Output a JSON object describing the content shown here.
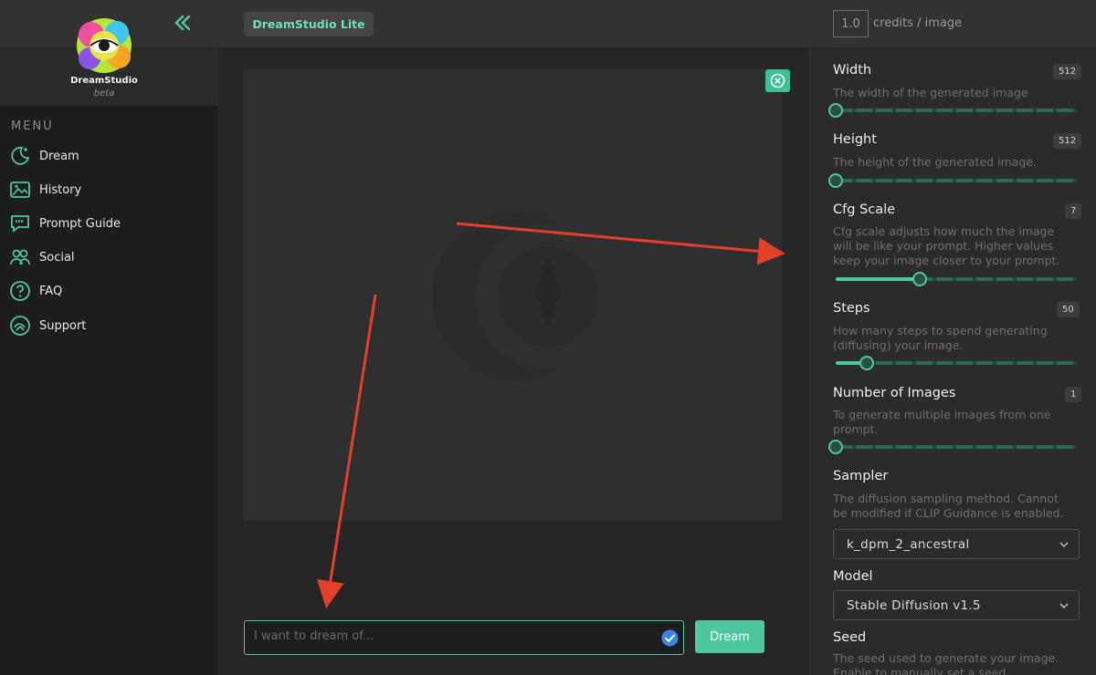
{
  "app": {
    "chip_label": "DreamStudio Lite",
    "brand": "DreamStudio",
    "brand_sub": "beta"
  },
  "credits": {
    "value": "1.0",
    "label": "credits / image"
  },
  "sidebar": {
    "menu_title": "MENU",
    "items": [
      {
        "label": "Dream",
        "icon": "dream-moon-icon"
      },
      {
        "label": "History",
        "icon": "history-image-icon"
      },
      {
        "label": "Prompt Guide",
        "icon": "prompt-guide-quote-icon"
      },
      {
        "label": "Social",
        "icon": "social-people-icon"
      },
      {
        "label": "FAQ",
        "icon": "faq-question-icon"
      },
      {
        "label": "Support",
        "icon": "support-icon"
      }
    ]
  },
  "prompt": {
    "placeholder": "I want to dream of...",
    "dream_label": "Dream"
  },
  "settings": {
    "width": {
      "title": "Width",
      "desc": "The width of the generated image",
      "value": "512",
      "fraction": 0.0
    },
    "height": {
      "title": "Height",
      "desc": "The height of the generated image.",
      "value": "512",
      "fraction": 0.0
    },
    "cfg": {
      "title": "Cfg Scale",
      "desc": "Cfg scale adjusts how much the image will be like your prompt. Higher values keep your image closer to your prompt.",
      "value": "7",
      "fraction": 0.35
    },
    "steps": {
      "title": "Steps",
      "desc": "How many steps to spend generating (diffusing) your image.",
      "value": "50",
      "fraction": 0.13
    },
    "num_images": {
      "title": "Number of Images",
      "desc": "To generate multiple images from one prompt.",
      "value": "1",
      "fraction": 0.0
    },
    "sampler": {
      "title": "Sampler",
      "desc": "The diffusion sampling method. Cannot be modified if CLIP Guidance is enabled.",
      "value": "k_dpm_2_ancestral"
    },
    "model": {
      "title": "Model",
      "value": "Stable Diffusion v1.5"
    },
    "seed": {
      "title": "Seed",
      "desc": "The seed used to generate your image. Enable to manually set a seed."
    }
  },
  "colors": {
    "accent": "#4fc6a0",
    "annotation_arrow": "#e3402b"
  }
}
